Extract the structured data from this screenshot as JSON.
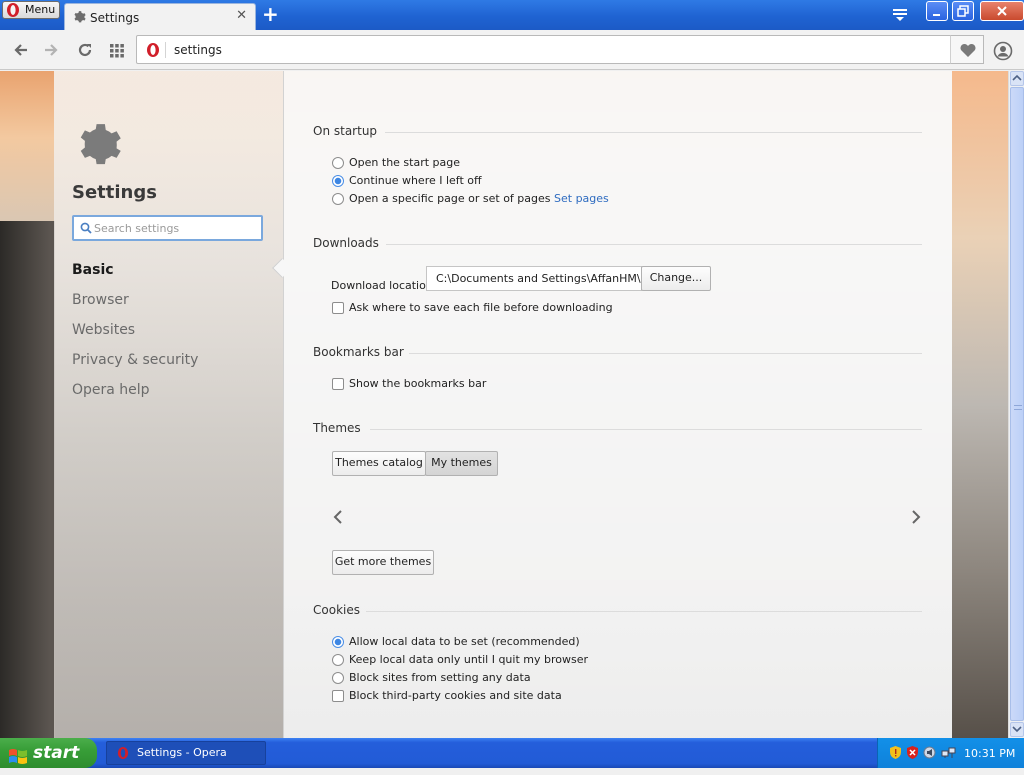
{
  "browser": {
    "menu_label": "Menu",
    "tab_title": "Settings",
    "address": "settings"
  },
  "sidebar": {
    "title": "Settings",
    "search_placeholder": "Search settings",
    "items": [
      {
        "label": "Basic",
        "active": true
      },
      {
        "label": "Browser"
      },
      {
        "label": "Websites"
      },
      {
        "label": "Privacy & security"
      },
      {
        "label": "Opera help"
      }
    ]
  },
  "sections": {
    "startup": {
      "heading": "On startup",
      "options": [
        {
          "label": "Open the start page",
          "selected": false
        },
        {
          "label": "Continue where I left off",
          "selected": true
        },
        {
          "label": "Open a specific page or set of pages",
          "selected": false,
          "link": "Set pages"
        }
      ]
    },
    "downloads": {
      "heading": "Downloads",
      "location_label": "Download location:",
      "location_value": "C:\\Documents and Settings\\AffanHM\\My",
      "change_button": "Change...",
      "ask_label": "Ask where to save each file before downloading",
      "ask_checked": false
    },
    "bookmarks": {
      "heading": "Bookmarks bar",
      "show_label": "Show the bookmarks bar",
      "show_checked": false
    },
    "themes": {
      "heading": "Themes",
      "tabs": [
        "Themes catalog",
        "My themes"
      ],
      "active_tab": "My themes",
      "more_button": "Get more themes"
    },
    "cookies": {
      "heading": "Cookies",
      "options": [
        {
          "label": "Allow local data to be set (recommended)",
          "selected": true
        },
        {
          "label": "Keep local data only until I quit my browser",
          "selected": false
        },
        {
          "label": "Block sites from setting any data",
          "selected": false
        }
      ],
      "third_party_label": "Block third-party cookies and site data",
      "third_party_checked": false
    }
  },
  "taskbar": {
    "start_label": "start",
    "task_label": "Settings - Opera",
    "clock": "10:31 PM"
  },
  "colors": {
    "opera_red": "#d11f2a",
    "link": "#2f6cc0",
    "radio_selected": "#3d86e3",
    "titlebar": "#1f63d2",
    "start_green": "#389e38"
  }
}
